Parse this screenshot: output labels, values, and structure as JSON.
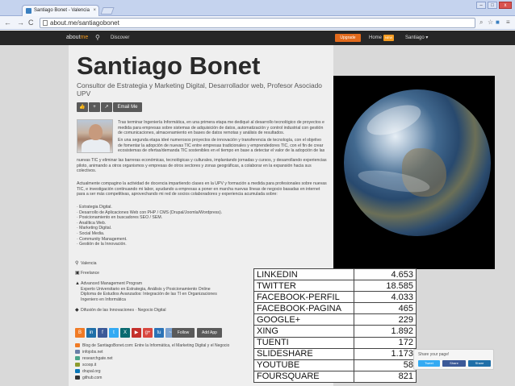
{
  "browser": {
    "tab_title": "Santiago Bonet - Valencia",
    "tab_close": "×",
    "url": "about.me/santiagobonet",
    "back": "←",
    "forward": "→",
    "reload": "C",
    "win_min": "–",
    "win_max": "□",
    "win_close": "x"
  },
  "aboutme_bar": {
    "logo_about": "about",
    "logo_me": "me",
    "search_icon": "search-icon",
    "discover": "Discover",
    "upgrade": "Upgrade",
    "home": "Home",
    "home_badge": "NEW",
    "user_menu": "Santiago ▾"
  },
  "profile": {
    "name": "Santiago Bonet",
    "headline": "Consultor de Estrategia y Marketing Digital, Desarrollador web, Profesor Asociado UPV",
    "actions": {
      "like": "👍",
      "add": "+",
      "share": "↗",
      "email": "Email Me"
    },
    "bio_1": "Tras terminar Ingeniería Informática, en una primera etapa me dediqué al desarrollo tecnológico de proyectos e medida para empresas sobre sistemas de adquisición de datos, automatización y control industrial con gestión de comunicaciones, almacenamiento en bases de datos remotas y análisis de resultados.",
    "bio_2": "En una segunda etapa ideé numerosos proyectos de innovación y transferencia de tecnología, con el objetivo de fomentar la adopción de nuevas TIC entre empresas tradicionales y emprendedores TIC, con el fin de crear ecosistemas de ofertas/demanda TIC sostenibles en el tiempo en base a detectar el valor de la adopción de las",
    "bio_2b": "nuevas TIC y eliminar las barreras económicas, tecnológicas y culturales, implantando jornadas y cursos, y desarrollando experiencias piloto, animando a otros organismos y empresas de otros sectores y zonas geográficas, a colaborar en la expansión hacia sus colectivos.",
    "bio_3": "Actualmente compagino la actividad de docencia impartiendo clases en la UPV y formación a medida para profesionales sobre nuevas TIC, e investigación continuando mi labor, ayudando a empresas a poner en marcha nuevas líneas de negocio basadas en internet para a ser más competitivas, aprovechando mi red de socios colaboradores y experiencia acumulada sobre:",
    "skills": [
      "· Estrategia Digital.",
      "· Desarrollo de Aplicaciones Web con PHP / CMS (Drupal/Joomla/Wordpress).",
      "· Posicionamiento en buscadores SEO / SEM.",
      "· Analítica Web.",
      "· Marketing Digital.",
      "· Social Media.",
      "· Community Management.",
      "· Gestión de la Innovación."
    ],
    "location": "Valencia",
    "work": "Freelance",
    "education": [
      "Advanced Management Program",
      "Experto Universitario en Estrategia, Análisis y Posicionamiento Online",
      "Diploma de Estudios Avanzados: Integración de las TI en Organizaciones",
      "Ingeniero en Informática"
    ],
    "interests": "Difusión de las Innovaciones · Negocio Digital",
    "follow": "Follow",
    "add_app": "Add App",
    "links": [
      "Blog de SantiagoBonet.com: Entre la Informática, el Marketing Digital y el Negocio",
      "infojobs.net",
      "researchgate.net",
      "scoop.it",
      "drupal.org",
      "github.com"
    ]
  },
  "stats_table": [
    {
      "label": "LINKEDIN",
      "value": "4.653"
    },
    {
      "label": "TWITTER",
      "value": "18.585"
    },
    {
      "label": "FACEBOOK-PERFIL",
      "value": "4.033"
    },
    {
      "label": "FACEBOOK-PAGINA",
      "value": "465"
    },
    {
      "label": "GOOGLE+",
      "value": "229"
    },
    {
      "label": "XING",
      "value": "1.892"
    },
    {
      "label": "TUENTI",
      "value": "172"
    },
    {
      "label": "SLIDESHARE",
      "value": "1.173"
    },
    {
      "label": "YOUTUBE",
      "value": "58"
    },
    {
      "label": "FOURSQUARE",
      "value": "821"
    }
  ],
  "share_box": {
    "title": "Share your page!",
    "tweet": "Tweet",
    "facebook": "Share",
    "linkedin": "Share"
  },
  "colors": {
    "accent": "#e26a1c",
    "header_bg": "#262626",
    "button_gray": "#5a5a5a"
  }
}
